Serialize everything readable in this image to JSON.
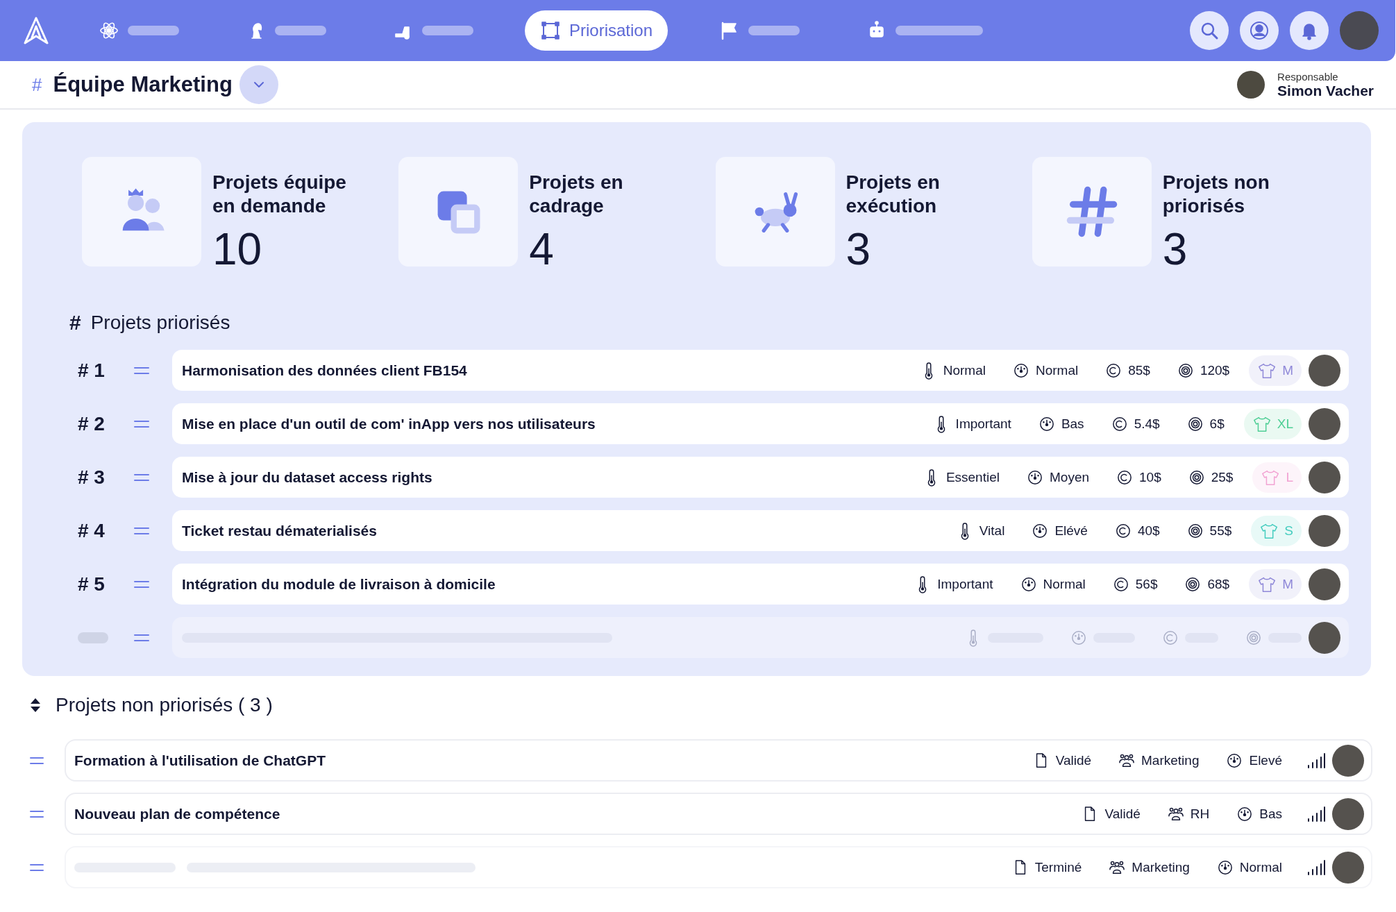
{
  "topbar": {
    "nav": [
      {
        "selected": false
      },
      {
        "selected": false
      },
      {
        "selected": false
      },
      {
        "label": "Priorisation",
        "selected": true
      },
      {
        "selected": false
      },
      {
        "selected": false
      }
    ]
  },
  "header": {
    "hash": "#",
    "title": "Équipe Marketing",
    "owner_label": "Responsable",
    "owner_name": "Simon Vacher"
  },
  "stats": [
    {
      "title": "Projets équipe en demande",
      "value": "10"
    },
    {
      "title": "Projets en cadrage",
      "value": "4"
    },
    {
      "title": "Projets en exécution",
      "value": "3"
    },
    {
      "title": "Projets non priorisés",
      "value": "3"
    }
  ],
  "prioritized": {
    "hash": "#",
    "title": "Projets priorisés",
    "rows": [
      {
        "kind": "project",
        "rank": "# 1",
        "title": "Harmonisation des données client FB154",
        "urgency": "Normal",
        "impact": "Normal",
        "cost": "85$",
        "gain": "120$",
        "size": "M",
        "color": "#8f88d8"
      },
      {
        "kind": "project",
        "rank": "# 2",
        "title": "Mise en place d'un outil de com' inApp vers nos utilisateurs",
        "urgency": "Important",
        "impact": "Bas",
        "cost": "5.4$",
        "gain": "6$",
        "size": "XL",
        "color": "#4fcf96"
      },
      {
        "kind": "project",
        "rank": "# 3",
        "title": "Mise à jour du dataset access rights",
        "urgency": "Essentiel",
        "impact": "Moyen",
        "cost": "10$",
        "gain": "25$",
        "size": "L",
        "color": "#f2a3d3"
      },
      {
        "kind": "project",
        "rank": "# 4",
        "title": "Ticket restau dématerialisés",
        "urgency": "Vital",
        "impact": "Elévé",
        "cost": "40$",
        "gain": "55$",
        "size": "S",
        "color": "#45cdbf"
      },
      {
        "kind": "project",
        "rank": "# 5",
        "title": "Intégration du module de livraison à domicile",
        "urgency": "Important",
        "impact": "Normal",
        "cost": "56$",
        "gain": "68$",
        "size": "M",
        "color": "#8f88d8"
      },
      {
        "kind": "placeholder"
      }
    ]
  },
  "unprioritized": {
    "title": "Projets non priorisés ( 3 )",
    "rows": [
      {
        "kind": "project",
        "title": "Formation à l'utilisation de ChatGPT",
        "status": "Validé",
        "team": "Marketing",
        "impact": "Elevé"
      },
      {
        "kind": "project",
        "title": "Nouveau plan de compétence",
        "status": "Validé",
        "team": "RH",
        "impact": "Bas"
      },
      {
        "kind": "placeholder",
        "status": "Terminé",
        "team": "Marketing",
        "impact": "Normal"
      }
    ]
  }
}
